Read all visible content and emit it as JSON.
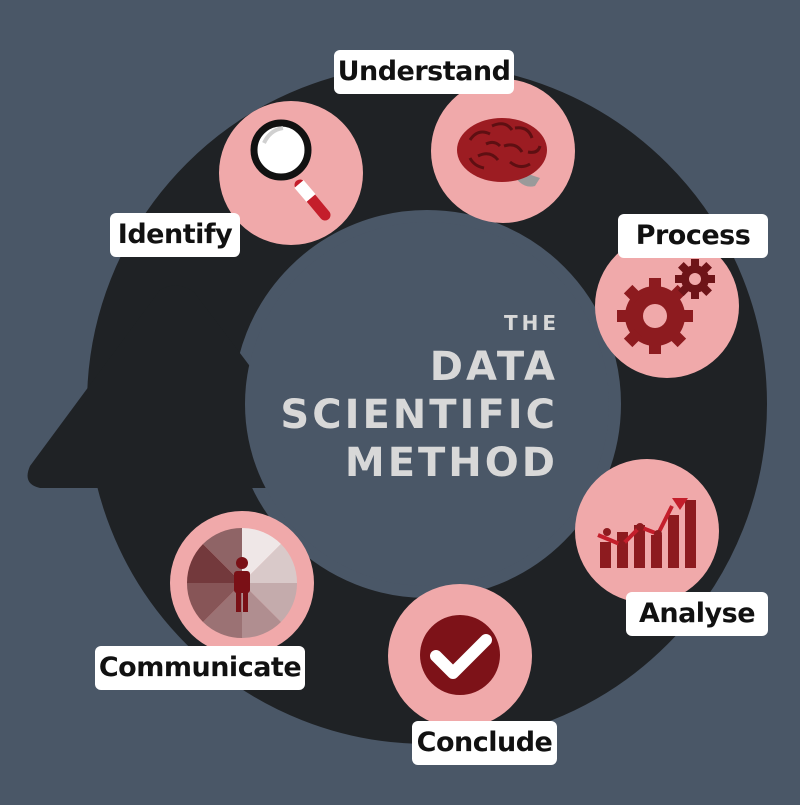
{
  "title": {
    "the": "THE",
    "line1": "DATA",
    "line2": "SCIENTIFIC",
    "line3": "METHOD"
  },
  "steps": [
    {
      "label": "Understand",
      "icon": "brain-icon"
    },
    {
      "label": "Process",
      "icon": "gears-icon"
    },
    {
      "label": "Analyse",
      "icon": "bar-chart-icon"
    },
    {
      "label": "Conclude",
      "icon": "checkmark-icon"
    },
    {
      "label": "Communicate",
      "icon": "person-circle-icon"
    },
    {
      "label": "Identify",
      "icon": "magnifier-icon"
    }
  ],
  "colors": {
    "background": "#4a5767",
    "ring": "#1f2225",
    "circle": "#f0a9aa",
    "accent": "#8d1b1f"
  }
}
